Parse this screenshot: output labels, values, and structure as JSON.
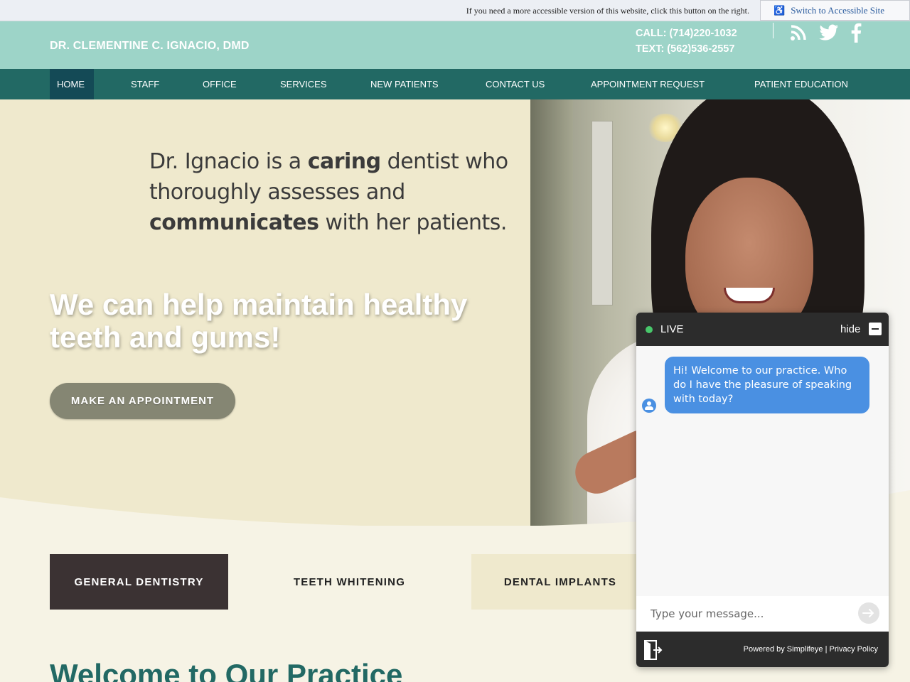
{
  "accessibility": {
    "notice": "If you need a more accessible version of this website, click this button on the right.",
    "button_label": "Switch to Accessible Site",
    "icon": "wheelchair-icon"
  },
  "header": {
    "brand": "DR. CLEMENTINE C. IGNACIO, DMD",
    "call": "CALL: (714)220-1032",
    "text": "TEXT: (562)536-2557",
    "social_icons": [
      "rss-icon",
      "twitter-icon",
      "facebook-icon"
    ]
  },
  "nav": {
    "items": [
      {
        "label": "HOME",
        "active": true
      },
      {
        "label": "STAFF"
      },
      {
        "label": "OFFICE"
      },
      {
        "label": "SERVICES"
      },
      {
        "label": "NEW PATIENTS"
      },
      {
        "label": "CONTACT US"
      },
      {
        "label": "APPOINTMENT REQUEST"
      },
      {
        "label": "PATIENT EDUCATION"
      }
    ]
  },
  "hero": {
    "tagline": {
      "part1": "Dr. Ignacio is a ",
      "bold1": "caring",
      "part2": " dentist who thoroughly assesses and ",
      "bold2": "communicates",
      "part3": " with her patients."
    },
    "headline": "We can help maintain healthy teeth and gums!",
    "cta": "MAKE AN APPOINTMENT"
  },
  "services": {
    "tabs": [
      "GENERAL DENTISTRY",
      "TEETH WHITENING",
      "DENTAL IMPLANTS"
    ]
  },
  "welcome": {
    "title": "Welcome to Our Practice"
  },
  "chat": {
    "status": "LIVE",
    "hide_label": "hide",
    "message": "Hi! Welcome to our practice.  Who do I have the pleasure of speaking with today?",
    "input_placeholder": "Type your message...",
    "powered_by": "Powered by Simplifeye",
    "separator": " | ",
    "privacy": "Privacy Policy"
  },
  "colors": {
    "header_bg": "#9dd4c8",
    "nav_bg": "#226964",
    "nav_active": "#144a56",
    "hero_bg": "#efe9cd",
    "cta_bg": "#858673",
    "tab_active": "#3b3233",
    "chat_bubble": "#4a90e2",
    "chat_dark": "#2c2c2c"
  }
}
